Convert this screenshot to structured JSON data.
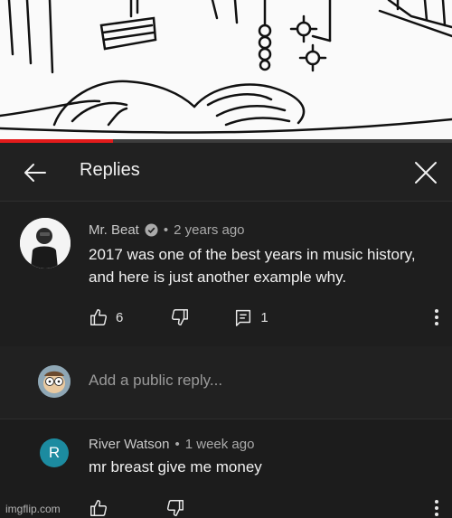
{
  "video": {
    "progress_fraction": 0.25
  },
  "header": {
    "title": "Replies",
    "back_icon": "arrow-left-icon",
    "close_icon": "close-icon"
  },
  "main_comment": {
    "author": "Mr. Beat",
    "separator": "•",
    "time": "2 years ago",
    "text": "2017 was one of the best years in music history, and here is just another example why.",
    "likes": "6",
    "replies": "1"
  },
  "reply_box": {
    "placeholder": "Add a public reply..."
  },
  "reply": {
    "avatar_letter": "R",
    "author": "River Watson",
    "separator": "•",
    "time": "1 week ago",
    "text": "mr breast give me  money"
  },
  "watermark": "imgflip.com",
  "colors": {
    "background": "#181818",
    "progress": "#e21b1b",
    "reply_avatar": "#1c8ba0"
  }
}
